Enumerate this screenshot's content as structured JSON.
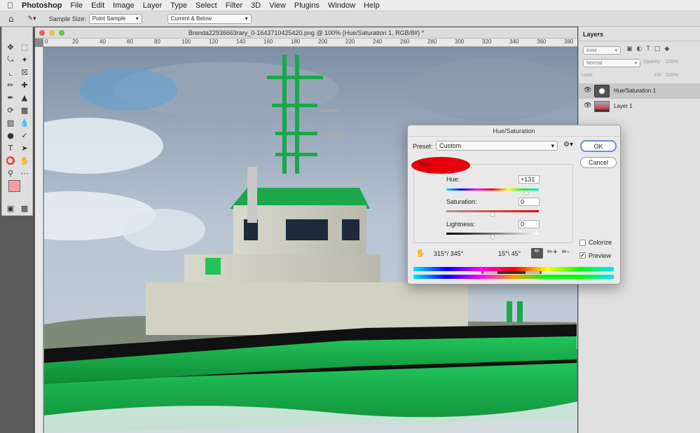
{
  "menubar": {
    "apple": "",
    "app": "Photoshop",
    "items": [
      "File",
      "Edit",
      "Image",
      "Layer",
      "Type",
      "Select",
      "Filter",
      "3D",
      "View",
      "Plugins",
      "Window",
      "Help"
    ]
  },
  "options": {
    "sample_size_label": "Sample Size:",
    "sample_size": "Point Sample",
    "sample_layers": "Current & Below"
  },
  "document": {
    "title": "Brenda22936663rary_0-1643710425420.png @ 100% (Hue/Saturation 1, RGB/8#) *",
    "ruler_labels": [
      "0",
      "20",
      "40",
      "60",
      "80",
      "100",
      "120",
      "140",
      "160",
      "180",
      "200",
      "220",
      "240",
      "260",
      "280",
      "300",
      "320",
      "340",
      "360",
      "380"
    ]
  },
  "layers_panel": {
    "title": "Layers",
    "kind": "Kind",
    "blend": "Normal",
    "opacity_label": "Opacity:",
    "opacity": "100%",
    "lock_label": "Lock:",
    "fill_label": "Fill:",
    "fill": "100%",
    "layers": [
      {
        "name": "Hue/Saturation 1"
      },
      {
        "name": "Layer 1"
      }
    ]
  },
  "dialog": {
    "title": "Hue/Saturation",
    "preset_label": "Preset:",
    "preset": "Custom",
    "channel": "Reds",
    "ok": "OK",
    "cancel": "Cancel",
    "hue_label": "Hue:",
    "hue": "+131",
    "saturation_label": "Saturation:",
    "saturation": "0",
    "lightness_label": "Lightness:",
    "lightness": "0",
    "range_left": "315°/ 345°",
    "range_right": "15°\\ 45°",
    "colorize": "Colorize",
    "preview": "Preview",
    "colorize_checked": false,
    "preview_checked": true,
    "hue_position": 0.86,
    "saturation_position": 0.5,
    "lightness_position": 0.5
  },
  "colors": {
    "highlight_red": "#e8000c",
    "ship_green": "#18b04a",
    "foreground_swatch": "#f4a0a0"
  }
}
